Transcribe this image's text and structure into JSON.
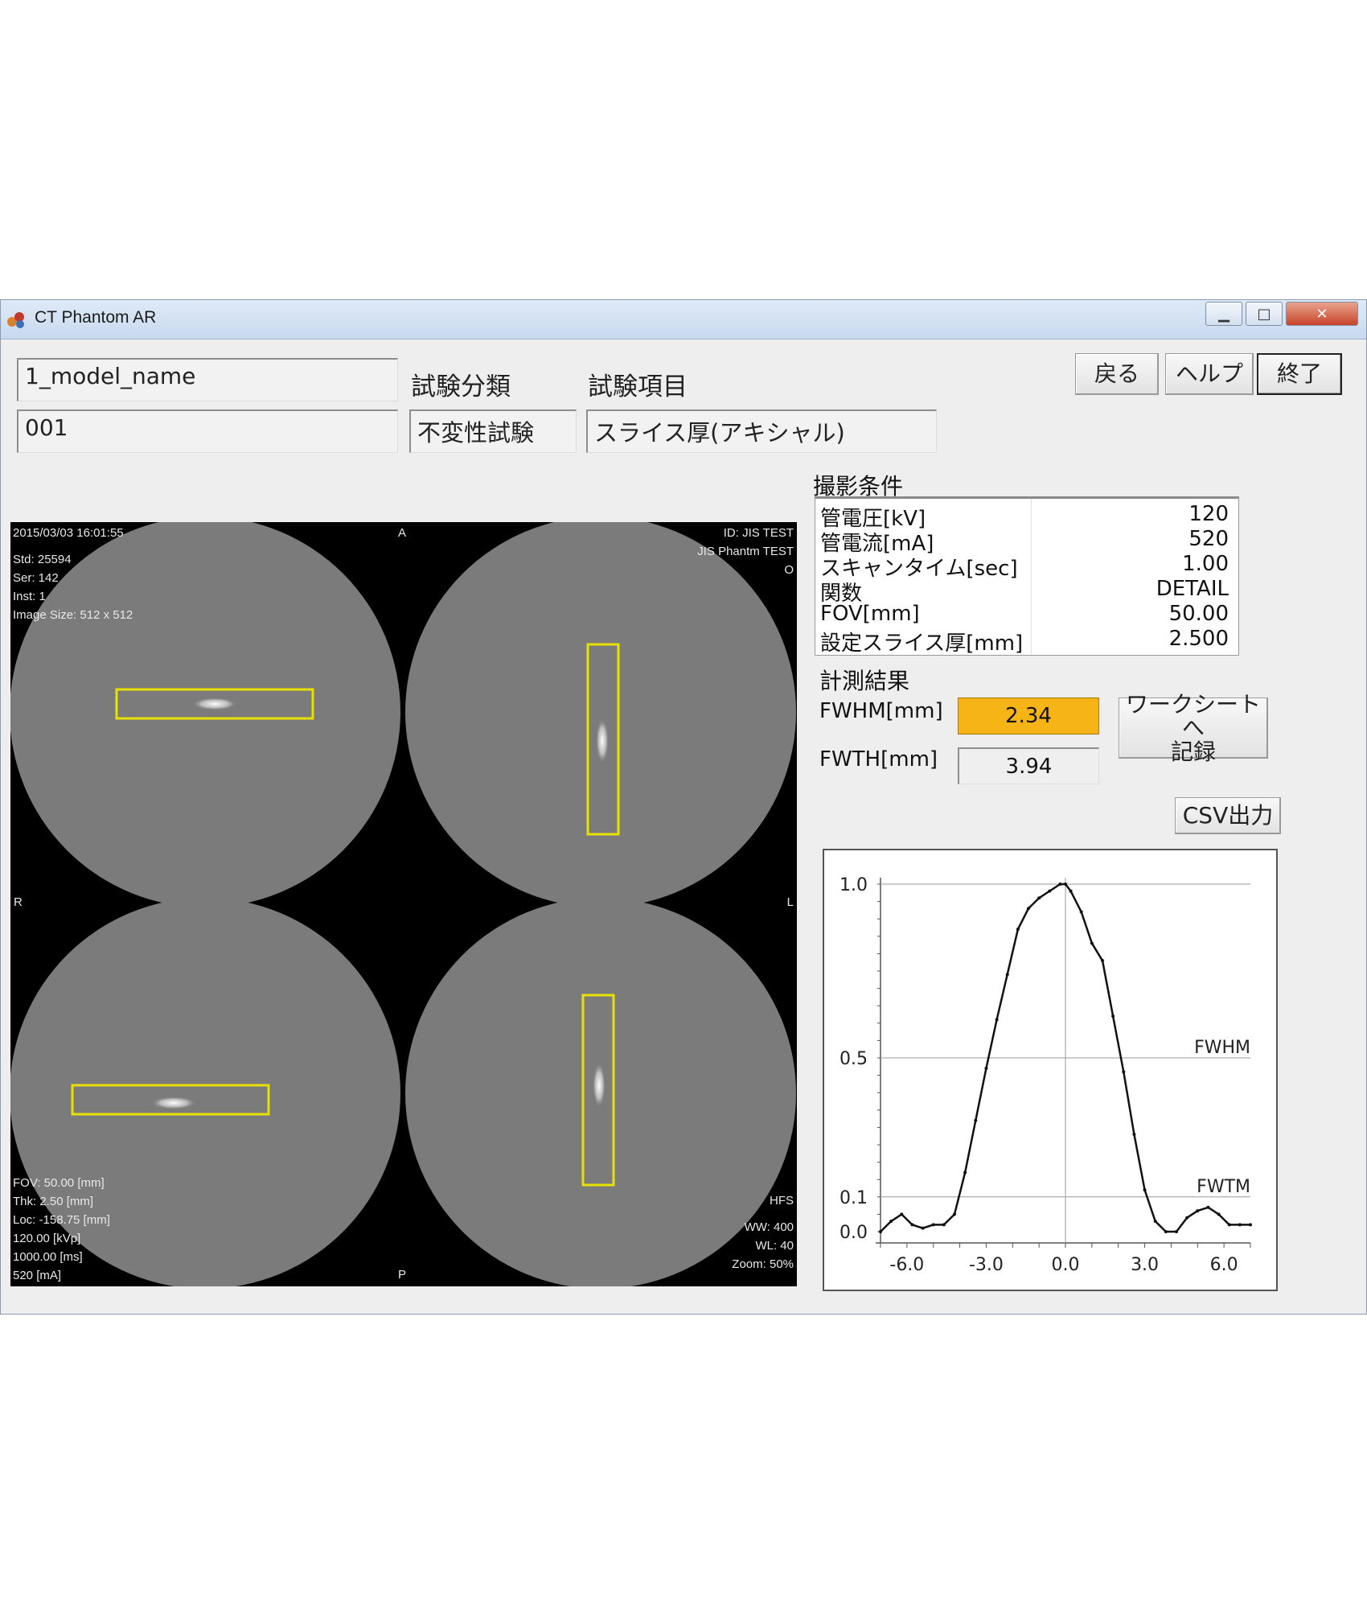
{
  "window": {
    "title": "CT Phantom AR"
  },
  "fields": {
    "model_name": "1_model_name",
    "id": "001",
    "category_label": "試験分類",
    "category_value": "不変性試験",
    "item_label": "試験項目",
    "item_value": "スライス厚(アキシャル)"
  },
  "buttons": {
    "back": "戻る",
    "help": "ヘルプ",
    "exit": "終了",
    "record": "ワークシートへ\n記録",
    "csv": "CSV出力"
  },
  "viewer": {
    "top_left": [
      "2015/03/03 16:01:55",
      "",
      "Std: 25594",
      "Ser: 142",
      "Inst: 1",
      "Image Size: 512 x 512"
    ],
    "top_right": [
      "ID: JIS TEST",
      "JIS Phantm TEST",
      "O"
    ],
    "top_center": "A",
    "mid_left": "R",
    "mid_right": "L",
    "bottom_center": "P",
    "bottom_left": [
      "FOV: 50.00 [mm]",
      "Thk: 2.50 [mm]",
      "Loc: -158.75 [mm]",
      "120.00 [kVp]",
      "1000.00 [ms]",
      "520 [mA]"
    ],
    "bottom_right": [
      "HFS",
      "",
      "WW: 400",
      "WL: 40",
      "Zoom: 50%"
    ],
    "roi_color": "#e8e000"
  },
  "conditions": {
    "title": "撮影条件",
    "rows": [
      {
        "key": "管電圧[kV]",
        "value": "120"
      },
      {
        "key": "管電流[mA]",
        "value": "520"
      },
      {
        "key": "スキャンタイム[sec]",
        "value": "1.00"
      },
      {
        "key": "関数",
        "value": "DETAIL"
      },
      {
        "key": "FOV[mm]",
        "value": "50.00"
      },
      {
        "key": "設定スライス厚[mm]",
        "value": "2.500"
      }
    ]
  },
  "results": {
    "title": "計測結果",
    "fwhm_label": "FWHM[mm]",
    "fwhm_value": "2.34",
    "fwtm_label": "FWTH[mm]",
    "fwtm_value": "3.94",
    "highlight_color": "#f7b417"
  },
  "chart_data": {
    "type": "line",
    "xlim": [
      -7.0,
      7.0
    ],
    "ylim": [
      0.0,
      1.0
    ],
    "xticks": [
      "-6.0",
      "-3.0",
      "0.0",
      "3.0",
      "6.0"
    ],
    "yticks": [
      "1.0",
      "0.5",
      "0.1",
      "0.0"
    ],
    "reference_lines": [
      {
        "label": "FWHM",
        "y": 0.5
      },
      {
        "label": "FWTM",
        "y": 0.1
      }
    ],
    "x": [
      -7.0,
      -6.6,
      -6.2,
      -5.8,
      -5.4,
      -5.0,
      -4.6,
      -4.2,
      -3.8,
      -3.4,
      -3.0,
      -2.6,
      -2.2,
      -1.8,
      -1.4,
      -1.0,
      -0.6,
      -0.2,
      0.0,
      0.2,
      0.6,
      1.0,
      1.4,
      1.8,
      2.2,
      2.6,
      3.0,
      3.4,
      3.8,
      4.2,
      4.6,
      5.0,
      5.4,
      5.8,
      6.2,
      6.6,
      7.0
    ],
    "y": [
      0.0,
      0.03,
      0.05,
      0.02,
      0.01,
      0.02,
      0.02,
      0.05,
      0.17,
      0.32,
      0.47,
      0.61,
      0.74,
      0.87,
      0.93,
      0.96,
      0.98,
      1.0,
      1.0,
      0.98,
      0.92,
      0.83,
      0.78,
      0.62,
      0.46,
      0.28,
      0.12,
      0.03,
      0.0,
      0.0,
      0.04,
      0.06,
      0.07,
      0.05,
      0.02,
      0.02,
      0.02
    ]
  }
}
